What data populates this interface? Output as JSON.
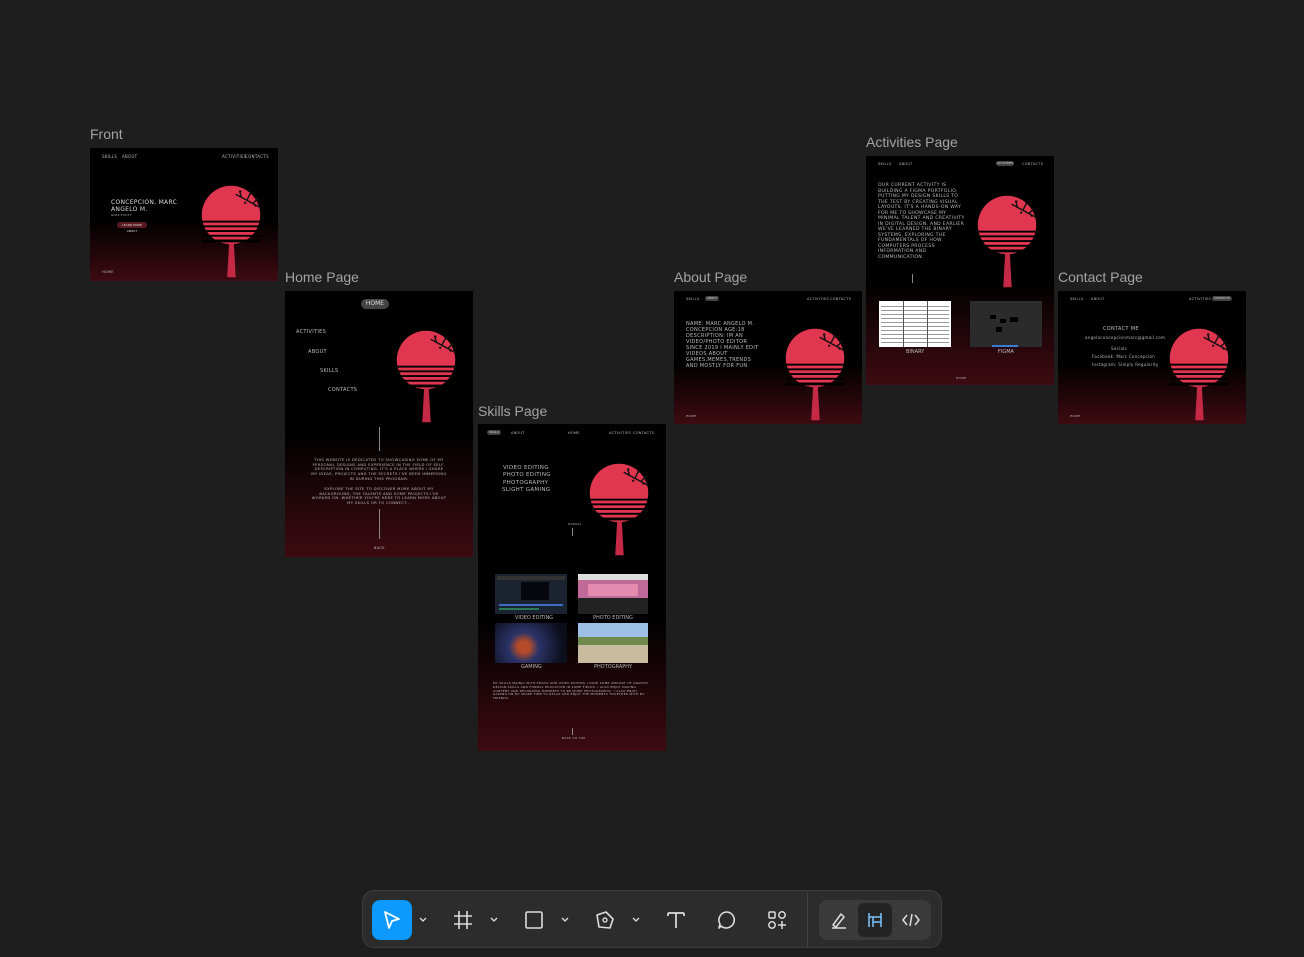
{
  "canvas": {
    "frames": [
      {
        "name": "Front"
      },
      {
        "name": "Home Page"
      },
      {
        "name": "Skills Page"
      },
      {
        "name": "About Page"
      },
      {
        "name": "Activities Page"
      },
      {
        "name": "Contact Page"
      }
    ]
  },
  "front": {
    "nav": [
      "SKILLS",
      "ABOUT",
      "ACTIVITIES",
      "CONTACTS"
    ],
    "name_line1": "CONCEPCION, MARC",
    "name_line2": "ANGELO M.",
    "subtitle": "ALEX-TIVITY",
    "button": "LEARN MORE ABOUT",
    "footer": "HOME"
  },
  "home": {
    "pill": "HOME",
    "menu": [
      "ACTIVITIES",
      "ABOUT",
      "SKILLS",
      "CONTACTS"
    ],
    "para1": "THIS WEBSITE IS DEDICATED TO SHOWCASING SOME OF MY PERSONAL DESIGNS AND EXPERIENCE IN THE FIELD OF SELF-DESCRIPTION IN COMPUTING. IT'S A PLACE WHERE I SHARE MY IDEAS, PROJECTS AND THE SECRETS I'VE BEEN IMMERSING IN DURING THIS PROGRAM.",
    "para2": "EXPLORE THE SITE TO DISCOVER MORE ABOUT MY BACKGROUND, THE TALENTS AND SOME PROJECTS I'VE WORKED ON. WHETHER YOU'RE HERE TO LEARN MORE ABOUT MY SKILLS OR TO CONNECT...",
    "footer": "BACK"
  },
  "skills": {
    "nav": [
      "SKILLS",
      "ABOUT",
      "HOME",
      "ACTIVITIES",
      "CONTACTS"
    ],
    "list": [
      "VIDEO EDITING",
      "PHOTO EDITING",
      "PHOTOGRAPHY",
      "SLIGHT GAMING"
    ],
    "scroll_label": "SCROLL",
    "tiles": [
      "VIDEO EDITING",
      "PHOTO EDITING",
      "GAMING",
      "PHOTOGRAPHY"
    ],
    "para": "MY SKILLS MAINLY WITH PHOTO AND VIDEO EDITING I HAVE SOME AMOUNT OF GRAPHIC DESIGN SKILLS AND FORMAL EDUCATION IN SOME FIELDS. I ALSO ENJOY MAKING CONTENT AND RECORDING MOMENTS TO BE MORE PHOTOGRAPHIC. I ALSO ENJOY GAMING ON MY SPARE TIME TO RELAX AND ENJOY THE MOMENTS TOGETHER WITH MY FRIENDS.",
    "footer": "BACK TO TOP"
  },
  "about": {
    "nav": [
      "SKILLS",
      "ABOUT",
      "ACTIVITIES",
      "CONTACTS"
    ],
    "text": "NAME: MARC ANGELO M. CONCEPCION AGE:18 DESCRIPTION: IM AN VIDEO/PHOTO EDITOR SINCE 2019 I MAINLY EDIT VIDEOS ABOUT GAMES,MEMES,TRENDS AND MOSTLY FOR FUN",
    "footer": "HOME"
  },
  "activities": {
    "nav": [
      "SKILLS",
      "ABOUT",
      "ACTIVITIES",
      "CONTACTS"
    ],
    "text": "OUR CURRENT ACTIVITY IS BUILDING A FIGMA PORTFOLIO, PUTTING MY DESIGN SKILLS TO THE TEST BY CREATING VISUAL LAYOUTS. IT'S A HANDS-ON WAY FOR ME TO SHOWCASE MY MINIMAL TALENT AND CREATIVITY IN DIGITAL DESIGN. AND EARLIER WE'VE LEARNED THE BINARY SYSTEMS, EXPLORING THE FUNDAMENTALS OF HOW COMPUTERS PROCESS INFORMATION AND COMMUNICATION.",
    "caption_binary": "BINARY",
    "caption_figma": "FIGMA",
    "footer": "HOME"
  },
  "contact": {
    "nav": [
      "SKILLS",
      "ABOUT",
      "ACTIVITIES",
      "CONTACTS"
    ],
    "heading": "CONTACT ME",
    "email": "angeloconcepcionmarc@gmail.com",
    "socials_label": "Socials",
    "facebook": "Facebook: Marc Concepcion",
    "instagram": "Instagram: Simply Regularity",
    "footer": "HOME"
  },
  "toolbar": {
    "tools": [
      "move-tool",
      "frame-tool",
      "shape-tool",
      "pen-tool",
      "text-tool",
      "comment-tool",
      "actions-tool"
    ],
    "modes": [
      "draw-mode",
      "design-mode",
      "dev-mode"
    ],
    "accent": "#0d99ff"
  }
}
